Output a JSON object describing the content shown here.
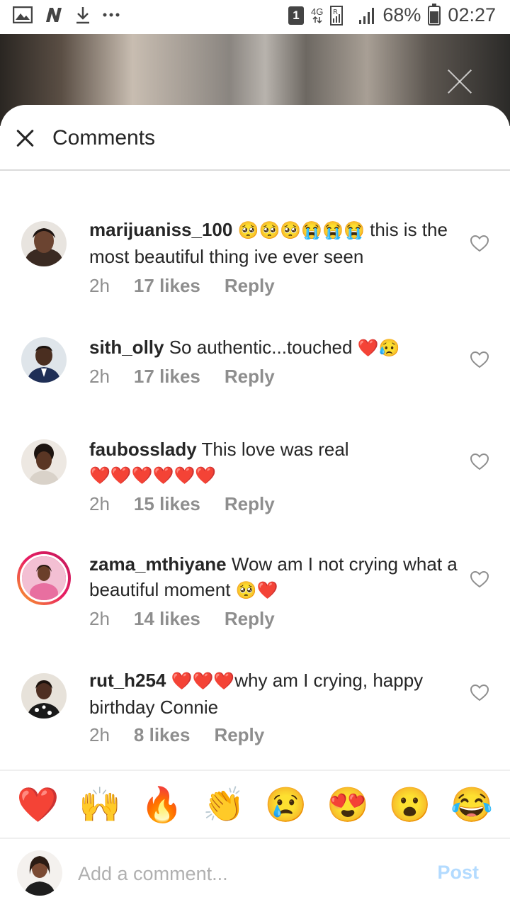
{
  "status_bar": {
    "sim_slot": "1",
    "network": "4G",
    "battery": "68%",
    "battery_level": 0.68,
    "time": "02:27"
  },
  "sheet": {
    "title": "Comments"
  },
  "comments": [
    {
      "username": "marijuaniss_100",
      "emojis": "🥺🥺🥺😭😭😭",
      "text": "this is the most beautiful thing ive ever seen",
      "time": "2h",
      "likes": "17 likes",
      "reply": "Reply"
    },
    {
      "username": "sith_olly",
      "text": "So authentic...touched",
      "emojis": "❤️😥",
      "time": "2h",
      "likes": "17 likes",
      "reply": "Reply"
    },
    {
      "username": "faubosslady",
      "text": "This love was real",
      "emojis": "❤️❤️❤️❤️❤️❤️",
      "time": "2h",
      "likes": "15 likes",
      "reply": "Reply"
    },
    {
      "username": "zama_mthiyane",
      "text": "Wow am I not crying what a beautiful moment",
      "emojis": "🥺❤️",
      "time": "2h",
      "likes": "14 likes",
      "reply": "Reply"
    },
    {
      "username": "rut_h254",
      "emojis": "❤️❤️❤️",
      "text": "why am I crying, happy birthday Connie",
      "time": "2h",
      "likes": "8 likes",
      "reply": "Reply"
    }
  ],
  "emoji_bar": [
    "❤️",
    "🙌",
    "🔥",
    "👏",
    "😢",
    "😍",
    "😮",
    "😂"
  ],
  "composer": {
    "placeholder": "Add a comment...",
    "post_label": "Post"
  }
}
